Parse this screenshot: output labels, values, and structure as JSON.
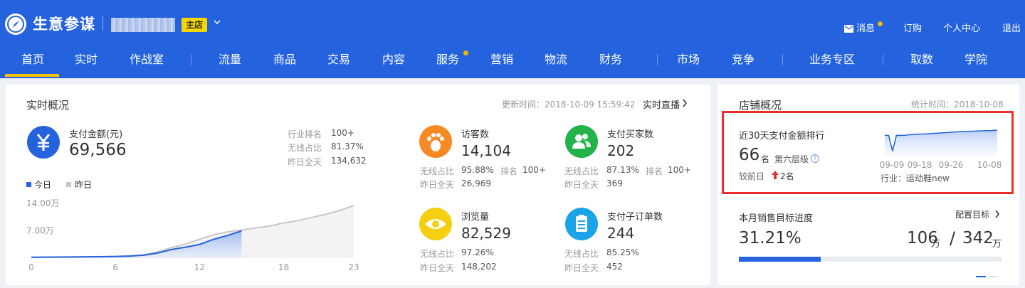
{
  "header": {
    "brand": "生意参谋",
    "shop_badge": "主店",
    "utils": {
      "message": "消息",
      "subscribe": "订购",
      "profile": "个人中心",
      "logout": "退出"
    },
    "nav": [
      {
        "label": "首页",
        "active": true
      },
      {
        "label": "实时"
      },
      {
        "label": "作战室"
      },
      {
        "label": "流量"
      },
      {
        "label": "商品"
      },
      {
        "label": "交易"
      },
      {
        "label": "内容"
      },
      {
        "label": "服务"
      },
      {
        "label": "营销"
      },
      {
        "label": "物流"
      },
      {
        "label": "财务"
      },
      {
        "label": "市场"
      },
      {
        "label": "竞争"
      },
      {
        "label": "业务专区"
      },
      {
        "label": "取数"
      },
      {
        "label": "学院"
      }
    ]
  },
  "realtime": {
    "title": "实时概况",
    "updated": "更新时间：2018-10-09 15:59:42",
    "live_link": "实时直播",
    "payment": {
      "label": "支付金额(元)",
      "value": "69,566",
      "rank_label": "行业排名",
      "rank_value": "100+",
      "wireless_label": "无线占比",
      "wireless_value": "81.37%",
      "yesterday_label": "昨日全天",
      "yesterday_value": "134,632"
    },
    "legend": {
      "today": "今日",
      "yesterday": "昨日"
    },
    "visitors": {
      "label": "访客数",
      "value": "14,104",
      "wireless_label": "无线占比",
      "wireless_value": "95.88%",
      "rank_label": "排名",
      "rank_value": "100+",
      "yesterday_label": "昨日全天",
      "yesterday_value": "26,969"
    },
    "buyers": {
      "label": "支付买家数",
      "value": "202",
      "wireless_label": "无线占比",
      "wireless_value": "87.13%",
      "rank_label": "排名",
      "rank_value": "100+",
      "yesterday_label": "昨日全天",
      "yesterday_value": "369"
    },
    "pageviews": {
      "label": "浏览量",
      "value": "82,529",
      "wireless_label": "无线占比",
      "wireless_value": "97.26%",
      "yesterday_label": "昨日全天",
      "yesterday_value": "148,202"
    },
    "suborders": {
      "label": "支付子订单数",
      "value": "244",
      "wireless_label": "无线占比",
      "wireless_value": "85.25%",
      "yesterday_label": "昨日全天",
      "yesterday_value": "452"
    }
  },
  "store": {
    "title": "店铺概况",
    "stat_time": "统计时间：2018-10-08",
    "ranking": {
      "title": "近30天支付金额排行",
      "rank": "66",
      "rank_unit": "名",
      "level": "第六层级",
      "compare_label": "较前日",
      "compare_value": "2名",
      "industry": "行业：运动鞋new"
    },
    "target": {
      "title": "本月销售目标进度",
      "config": "配置目标",
      "percent": "31.21%",
      "progress": 0.3121,
      "achieved": "106",
      "total": "342",
      "unit": "万",
      "slash": "/"
    }
  },
  "chart_data": [
    {
      "type": "line",
      "x_ticks": [
        "0",
        "6",
        "12",
        "18",
        "23"
      ],
      "y_ticks": [
        "14.00万",
        "7.00万"
      ],
      "xlim": [
        0,
        23
      ],
      "ylim": [
        0,
        140000
      ],
      "series": [
        {
          "name": "今日",
          "color": "#2463dd",
          "x": [
            0,
            1,
            2,
            3,
            4,
            5,
            6,
            7,
            8,
            9,
            10,
            11,
            12,
            13,
            14,
            15
          ],
          "y": [
            2000,
            2400,
            2700,
            3000,
            3300,
            3600,
            4200,
            5200,
            7500,
            13000,
            22000,
            28000,
            35000,
            48000,
            58000,
            69566
          ]
        },
        {
          "name": "昨日",
          "color": "#c8c8c8",
          "x": [
            0,
            1,
            2,
            3,
            4,
            5,
            6,
            7,
            8,
            9,
            10,
            11,
            12,
            13,
            14,
            15,
            16,
            17,
            18,
            19,
            20,
            21,
            22,
            23
          ],
          "y": [
            2200,
            2600,
            2900,
            3200,
            3500,
            3900,
            4500,
            5800,
            8500,
            16000,
            27000,
            36000,
            48000,
            60000,
            67000,
            72000,
            77000,
            82000,
            90000,
            96000,
            104000,
            112000,
            122000,
            134632
          ]
        }
      ]
    },
    {
      "type": "line",
      "title": "近30天支付金额排行",
      "x_ticks": [
        "09-09",
        "09-18",
        "09-26",
        "10-08"
      ],
      "series": [
        {
          "name": "排行",
          "color": "#2463dd",
          "x": [
            0,
            1,
            2,
            3,
            4,
            5,
            6,
            7,
            8,
            9,
            10,
            11,
            12,
            13,
            14,
            15,
            16,
            17,
            18,
            19,
            20,
            21,
            22,
            23,
            24,
            25,
            26,
            27,
            28,
            29
          ],
          "y": [
            8,
            8,
            2,
            8,
            8,
            8,
            8.2,
            8.3,
            8.4,
            8.5,
            8.5,
            8.6,
            8.7,
            8.8,
            8.9,
            9.0,
            9.1,
            9.2,
            9.3,
            9.4,
            9.5,
            9.5,
            9.6,
            9.6,
            9.7,
            9.7,
            9.8,
            9.8,
            9.9,
            10
          ]
        }
      ]
    }
  ]
}
